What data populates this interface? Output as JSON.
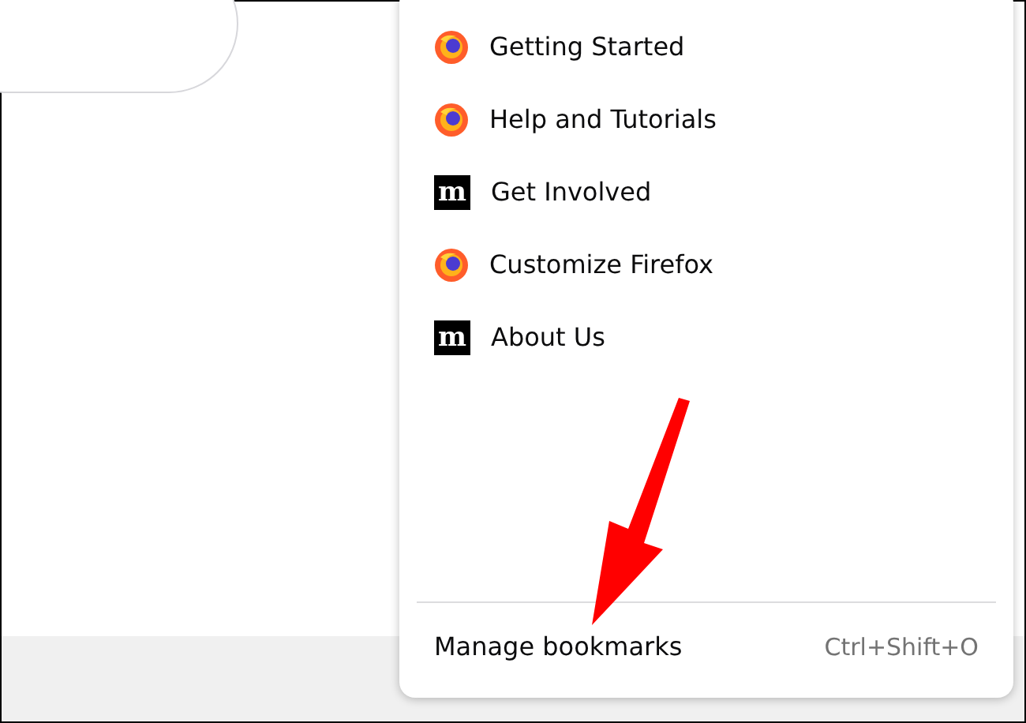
{
  "bookmarks_menu": {
    "items": [
      {
        "label": "Getting Started",
        "kind": "firefox"
      },
      {
        "label": "Help and Tutorials",
        "kind": "firefox"
      },
      {
        "label": "Get Involved",
        "kind": "mozilla",
        "icon_glyph": "m"
      },
      {
        "label": "Customize Firefox",
        "kind": "firefox"
      },
      {
        "label": "About Us",
        "kind": "mozilla",
        "icon_glyph": "m"
      }
    ],
    "footer": {
      "label": "Manage bookmarks",
      "shortcut": "Ctrl+Shift+O"
    }
  }
}
